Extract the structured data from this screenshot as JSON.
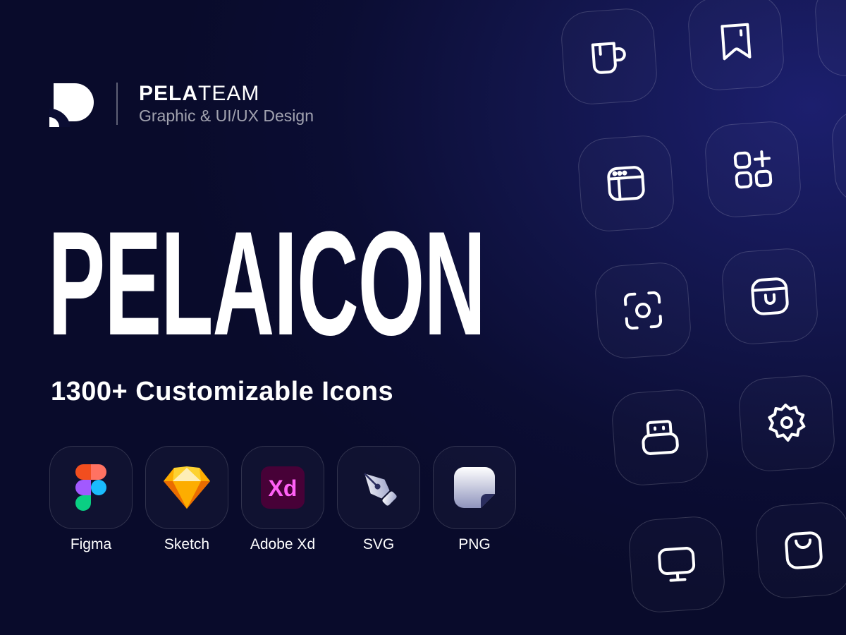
{
  "brand": {
    "name_bold": "PELA",
    "name_light": "TEAM",
    "tagline": "Graphic & UI/UX Design"
  },
  "hero": {
    "title": "PELAICON",
    "subtitle": "1300+ Customizable Icons"
  },
  "formats": [
    {
      "label": "Figma",
      "icon": "figma-icon"
    },
    {
      "label": "Sketch",
      "icon": "sketch-icon"
    },
    {
      "label": "Adobe Xd",
      "icon": "adobe-xd-icon",
      "icon_text": "Xd"
    },
    {
      "label": "SVG",
      "icon": "pen-tool-icon"
    },
    {
      "label": "PNG",
      "icon": "png-file-icon"
    }
  ],
  "showcase_icons": [
    "mug-icon",
    "bookmark-icon",
    "browser-window-icon",
    "add-widget-icon",
    "scan-icon",
    "pot-icon",
    "usb-drive-icon",
    "settings-icon",
    "monitor-icon",
    "shopping-bag-icon"
  ],
  "colors": {
    "background": "#0b0d33",
    "background_glow": "#1c1f6e",
    "text": "#ffffff",
    "xd_magenta": "#ff61f6",
    "xd_bg": "#470137",
    "sketch_orange": "#f7b500"
  }
}
